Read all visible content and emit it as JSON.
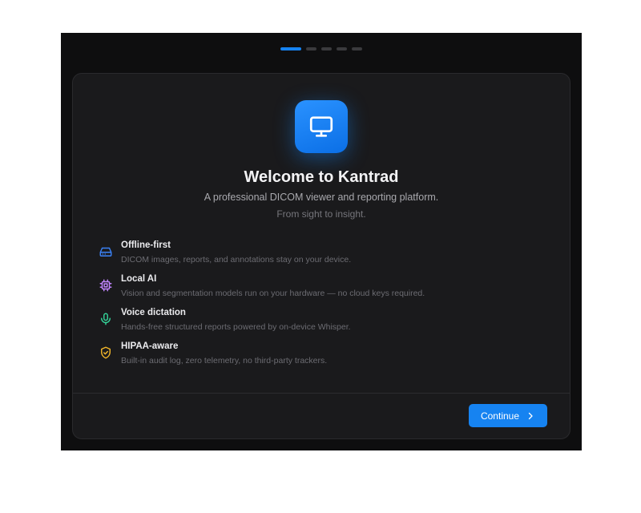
{
  "stepper": {
    "total": 5,
    "current": 1
  },
  "welcome": {
    "title": "Welcome to Kantrad",
    "subtitle": "A professional DICOM viewer and reporting platform.",
    "tagline": "From sight to insight.",
    "app_icon": "monitor-icon"
  },
  "features": [
    {
      "title": "Offline-first",
      "description": "DICOM images, reports, and annotations stay on your device.",
      "icon": "drive-icon",
      "color": "#3b82f6"
    },
    {
      "title": "Local AI",
      "description": "Vision and segmentation models run on your hardware — no cloud keys required.",
      "icon": "chip-icon",
      "color": "#c084fc"
    },
    {
      "title": "Voice dictation",
      "description": "Hands-free structured reports powered by on-device Whisper.",
      "icon": "microphone-icon",
      "color": "#34d399"
    },
    {
      "title": "HIPAA-aware",
      "description": "Built-in audit log, zero telemetry, no third-party trackers.",
      "icon": "shield-check-icon",
      "color": "#f5b829"
    }
  ],
  "footer": {
    "continue_label": "Continue",
    "continue_icon": "chevron-right-icon"
  },
  "colors": {
    "accent": "#1683f1",
    "background": "#0e0e0f",
    "card": "#1a1a1c"
  }
}
